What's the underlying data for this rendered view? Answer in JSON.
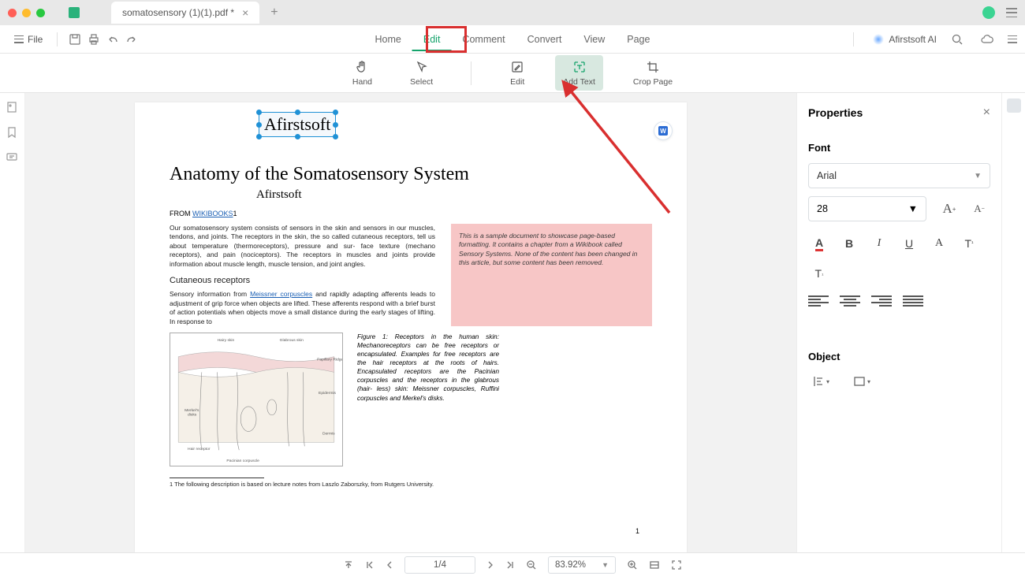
{
  "window": {
    "tab_title": "somatosensory (1)(1).pdf *"
  },
  "toolbar": {
    "file": "File",
    "menus": {
      "home": "Home",
      "edit": "Edit",
      "comment": "Comment",
      "convert": "Convert",
      "view": "View",
      "page": "Page"
    },
    "ai_label": "Afirstsoft AI"
  },
  "subtools": {
    "hand": "Hand",
    "select": "Select",
    "edit": "Edit",
    "add_text": "Add Text",
    "crop_page": "Crop Page"
  },
  "document": {
    "inserted_text": "Afirstsoft",
    "title": "Anatomy of the Somatosensory System",
    "subtitle": "Afirstsoft",
    "byline_prefix": "FROM ",
    "byline_link": "WIKIBOOKS",
    "byline_suffix": "1",
    "para1": "Our somatosensory system consists of sensors in the skin and sensors in our muscles, tendons, and joints. The receptors in the skin, the so called cutaneous receptors, tell us about temperature (thermoreceptors), pressure and sur- face texture (mechano receptors), and pain (nociceptors). The receptors in muscles and joints provide information about muscle length, muscle tension, and joint angles.",
    "section_head": "Cutaneous receptors",
    "para2_a": "Sensory information from ",
    "para2_link": "Meissner corpuscles",
    "para2_b": " and rapidly adapting afferents leads to adjustment of grip force when objects are lifted. These afferents respond with a brief burst of action potentials when objects move a small distance during the early stages of lifting. In response to",
    "note": "This is a sample document to showcase page-based formatting. It contains a chapter from a Wikibook called Sensory Systems. None of the content has been changed in this article, but some content has been removed.",
    "fig_caption": "Figure 1: Receptors in the human skin: Mechanoreceptors can be free receptors or encapsulated. Examples for free receptors are the hair receptors at the roots of hairs. Encapsulated receptors are the Pacinian corpuscles and the receptors in the glabrous (hair- less) skin: Meissner corpuscles, Ruffini corpuscles and Merkel's disks.",
    "footnote": "1 The following description is based on lecture notes from Laszlo Zaborszky, from Rutgers University.",
    "page_num": "1"
  },
  "properties": {
    "title": "Properties",
    "font_section": "Font",
    "font_family": "Arial",
    "font_size": "28",
    "object_section": "Object"
  },
  "status": {
    "page": "1/4",
    "zoom": "83.92%"
  },
  "colors": {
    "accent": "#14a36b",
    "highlight_box": "#d92f2f",
    "note_bg": "#f7c6c6"
  }
}
